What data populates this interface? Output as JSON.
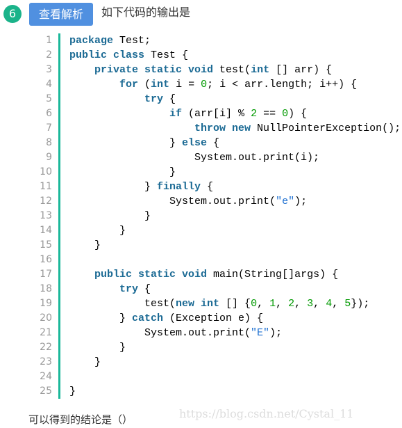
{
  "question": {
    "number": "6",
    "analysis_button": "查看解析",
    "prompt": "如下代码的输出是",
    "conclusion": "可以得到的结论是（）"
  },
  "watermark": "https://blog.csdn.net/Cystal_11",
  "colors": {
    "keyword": "#1b6a94",
    "number": "#009900",
    "string": "#1d6fd0",
    "accent": "#1bb89a",
    "button": "#5090e0"
  },
  "code": [
    [
      [
        "kw",
        "package"
      ],
      [
        "",
        "Test;"
      ]
    ],
    [
      [
        "kw",
        "public class"
      ],
      [
        "",
        "Test {"
      ]
    ],
    [
      [
        "",
        "    "
      ],
      [
        "kw",
        "private static void"
      ],
      [
        "",
        "test("
      ],
      [
        "kw",
        "int"
      ],
      [
        "",
        "[] arr) {"
      ]
    ],
    [
      [
        "",
        "        "
      ],
      [
        "kw",
        "for"
      ],
      [
        "",
        "("
      ],
      [
        "kw",
        "int"
      ],
      [
        "",
        "i = "
      ],
      [
        "num",
        "0"
      ],
      [
        "",
        "; i < arr.length; i++) {"
      ]
    ],
    [
      [
        "",
        "            "
      ],
      [
        "kw",
        "try"
      ],
      [
        "",
        "{"
      ]
    ],
    [
      [
        "",
        "                "
      ],
      [
        "kw",
        "if"
      ],
      [
        "",
        "(arr[i] % "
      ],
      [
        "num",
        "2"
      ],
      [
        "",
        "== "
      ],
      [
        "num",
        "0"
      ],
      [
        "",
        ") {"
      ]
    ],
    [
      [
        "",
        "                    "
      ],
      [
        "kw",
        "throw new"
      ],
      [
        "",
        "NullPointerException();"
      ]
    ],
    [
      [
        "",
        "                } "
      ],
      [
        "kw",
        "else"
      ],
      [
        "",
        "{"
      ]
    ],
    [
      [
        "",
        "                    System.out.print(i);"
      ]
    ],
    [
      [
        "",
        "                }"
      ]
    ],
    [
      [
        "",
        "            } "
      ],
      [
        "kw",
        "finally"
      ],
      [
        "",
        "{"
      ]
    ],
    [
      [
        "",
        "                System.out.print("
      ],
      [
        "str",
        "\"e\""
      ],
      [
        "",
        ");"
      ]
    ],
    [
      [
        "",
        "            }"
      ]
    ],
    [
      [
        "",
        "        }"
      ]
    ],
    [
      [
        "",
        "    }"
      ]
    ],
    [
      [
        "",
        ""
      ]
    ],
    [
      [
        "",
        "    "
      ],
      [
        "kw",
        "public static void"
      ],
      [
        "",
        "main(String[]args) {"
      ]
    ],
    [
      [
        "",
        "        "
      ],
      [
        "kw",
        "try"
      ],
      [
        "",
        "{"
      ]
    ],
    [
      [
        "",
        "            test("
      ],
      [
        "kw",
        "new int"
      ],
      [
        "",
        "[] {"
      ],
      [
        "num",
        "0"
      ],
      [
        "",
        ", "
      ],
      [
        "num",
        "1"
      ],
      [
        "",
        ", "
      ],
      [
        "num",
        "2"
      ],
      [
        "",
        ", "
      ],
      [
        "num",
        "3"
      ],
      [
        "",
        ", "
      ],
      [
        "num",
        "4"
      ],
      [
        "",
        ", "
      ],
      [
        "num",
        "5"
      ],
      [
        "",
        "});"
      ]
    ],
    [
      [
        "",
        "        } "
      ],
      [
        "kw",
        "catch"
      ],
      [
        "",
        "(Exception e) {"
      ]
    ],
    [
      [
        "",
        "            System.out.print("
      ],
      [
        "str",
        "\"E\""
      ],
      [
        "",
        ");"
      ]
    ],
    [
      [
        "",
        "        }"
      ]
    ],
    [
      [
        "",
        "    }"
      ]
    ],
    [
      [
        "",
        ""
      ]
    ],
    [
      [
        "",
        "}"
      ]
    ]
  ]
}
